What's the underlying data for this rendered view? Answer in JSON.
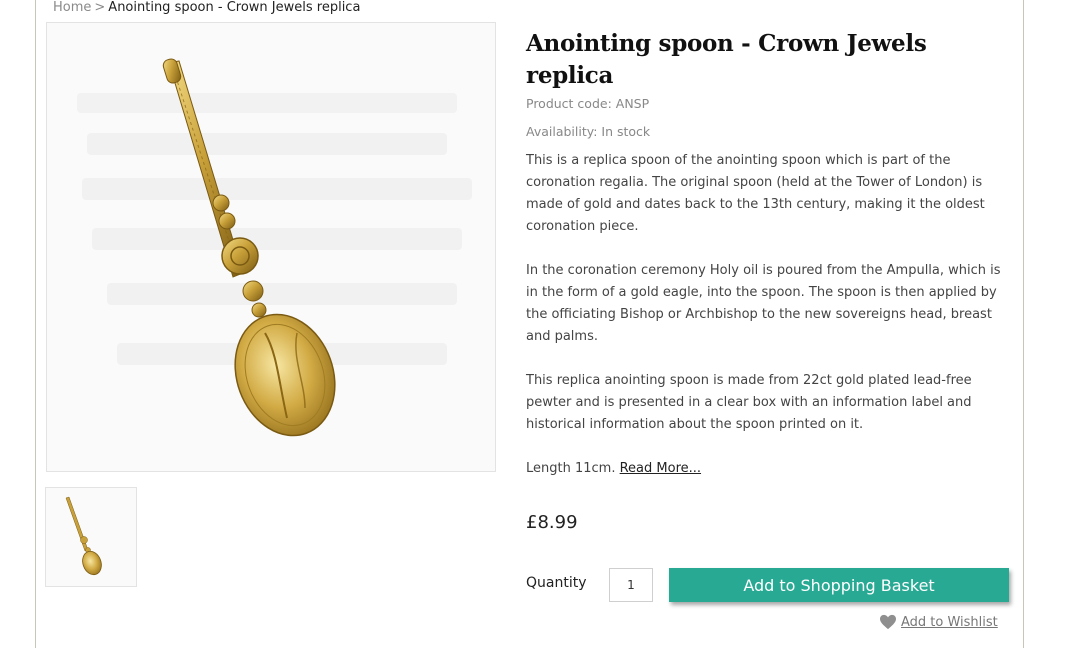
{
  "breadcrumb": {
    "home": "Home",
    "separator": ">",
    "current": "Anointing spoon - Crown Jewels replica"
  },
  "product": {
    "title": "Anointing spoon - Crown Jewels replica",
    "code": "Product code: ANSP",
    "availability": "Availability: In stock",
    "description": [
      "This is a replica spoon of the anointing spoon which is part of the coronation regalia. The original spoon (held at the Tower of London) is made of gold and dates back to the 13th century, making it the oldest coronation piece.",
      "In the coronation ceremony Holy oil is poured from the Ampulla, which is in the form of a gold eagle, into the spoon. The spoon is then applied by the officiating Bishop or Archbishop to the new sovereigns head, breast and palms.",
      "This replica anointing spoon is made from 22ct gold plated lead-free pewter and is presented in a clear box with an information label and historical information about the spoon printed on it."
    ],
    "length_text": "Length 11cm.",
    "read_more": "Read More...",
    "price": "£8.99"
  },
  "purchase": {
    "quantity_label": "Quantity",
    "quantity_value": "1",
    "add_button": "Add to Shopping Basket",
    "wishlist": "Add to Wishlist"
  },
  "icons": {
    "wishlist": "heart-icon",
    "main_image": "golden-spoon-image",
    "thumbnail": "golden-spoon-thumbnail"
  },
  "colors": {
    "accent": "#27a993",
    "gold": "#c9a13a"
  }
}
